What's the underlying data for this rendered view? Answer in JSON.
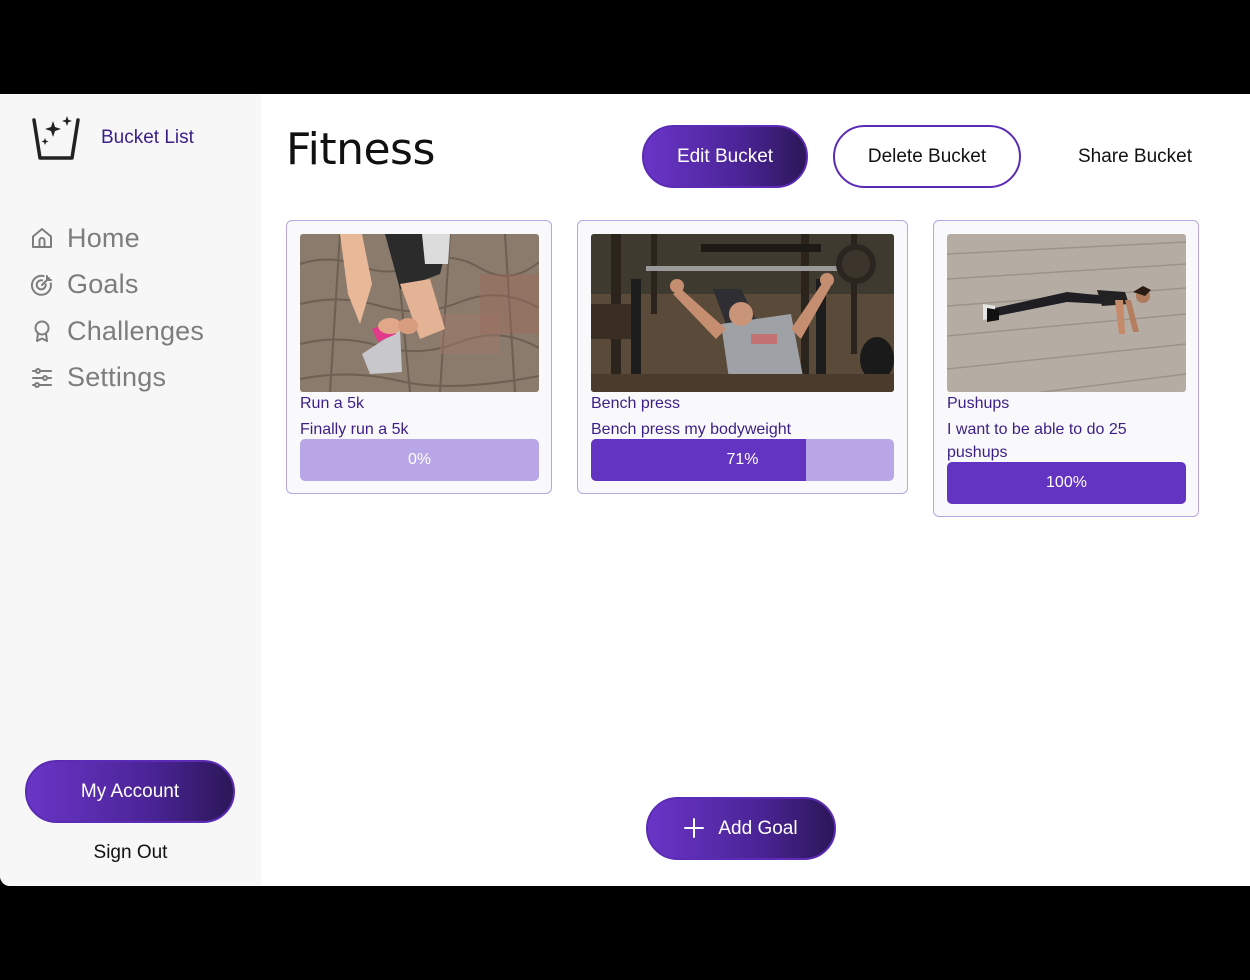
{
  "sidebar": {
    "brand_name": "Bucket List",
    "brand_icon": "bucket-sparkle-icon",
    "nav": [
      {
        "label": "Home",
        "icon": "home-icon"
      },
      {
        "label": "Goals",
        "icon": "target-icon"
      },
      {
        "label": "Challenges",
        "icon": "award-icon"
      },
      {
        "label": "Settings",
        "icon": "sliders-icon"
      }
    ],
    "account_label": "My Account",
    "signout_label": "Sign Out"
  },
  "header": {
    "title": "Fitness",
    "edit_label": "Edit Bucket",
    "delete_label": "Delete Bucket",
    "share_label": "Share Bucket"
  },
  "goals": [
    {
      "title": "Run a 5k",
      "description": "Finally run a 5k",
      "progress_label": "0%",
      "progress": 0
    },
    {
      "title": "Bench press",
      "description": "Bench press my bodyweight",
      "progress_label": "71%",
      "progress": 71
    },
    {
      "title": "Pushups",
      "description": "I want to be able to do 25 pushups",
      "progress_label": "100%",
      "progress": 100
    }
  ],
  "add_goal_label": "Add Goal",
  "colors": {
    "accent": "#6334c2",
    "accent_light": "#b8a6e6",
    "brand_text": "#3b1f86",
    "sidebar_bg": "#f7f7f8"
  }
}
